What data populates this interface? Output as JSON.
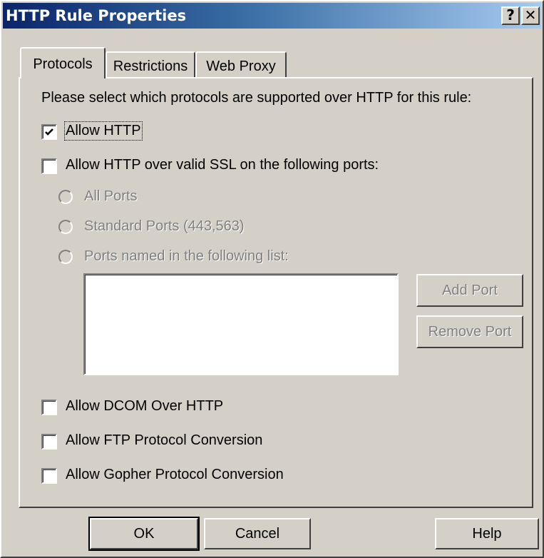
{
  "window": {
    "title": "HTTP Rule Properties",
    "help_glyph": "?",
    "close_glyph": "✕"
  },
  "tabs": [
    {
      "label": "Protocols",
      "selected": true
    },
    {
      "label": "Restrictions",
      "selected": false
    },
    {
      "label": "Web Proxy",
      "selected": false
    }
  ],
  "protocols": {
    "instruction": "Please select which protocols are supported over HTTP for this rule:",
    "allow_http": {
      "label": "Allow HTTP",
      "checked": true
    },
    "allow_ssl": {
      "label": "Allow HTTP over valid SSL on the following ports:",
      "checked": false
    },
    "ssl_options": [
      {
        "label": "All Ports",
        "enabled": false
      },
      {
        "label": "Standard Ports (443,563)",
        "enabled": false
      },
      {
        "label": "Ports named in the following list:",
        "enabled": false
      }
    ],
    "ports_list": [],
    "add_port_label": "Add Port",
    "remove_port_label": "Remove Port",
    "allow_dcom": {
      "label": "Allow DCOM Over HTTP",
      "checked": false
    },
    "allow_ftp": {
      "label": "Allow FTP Protocol Conversion",
      "checked": false
    },
    "allow_gopher": {
      "label": "Allow Gopher Protocol Conversion",
      "checked": false
    }
  },
  "buttons": {
    "ok": "OK",
    "cancel": "Cancel",
    "help": "Help"
  },
  "colors": {
    "face": "#d4d0c8",
    "title_start": "#0a246a",
    "title_end": "#a6caf0",
    "disabled_text": "#808080"
  }
}
